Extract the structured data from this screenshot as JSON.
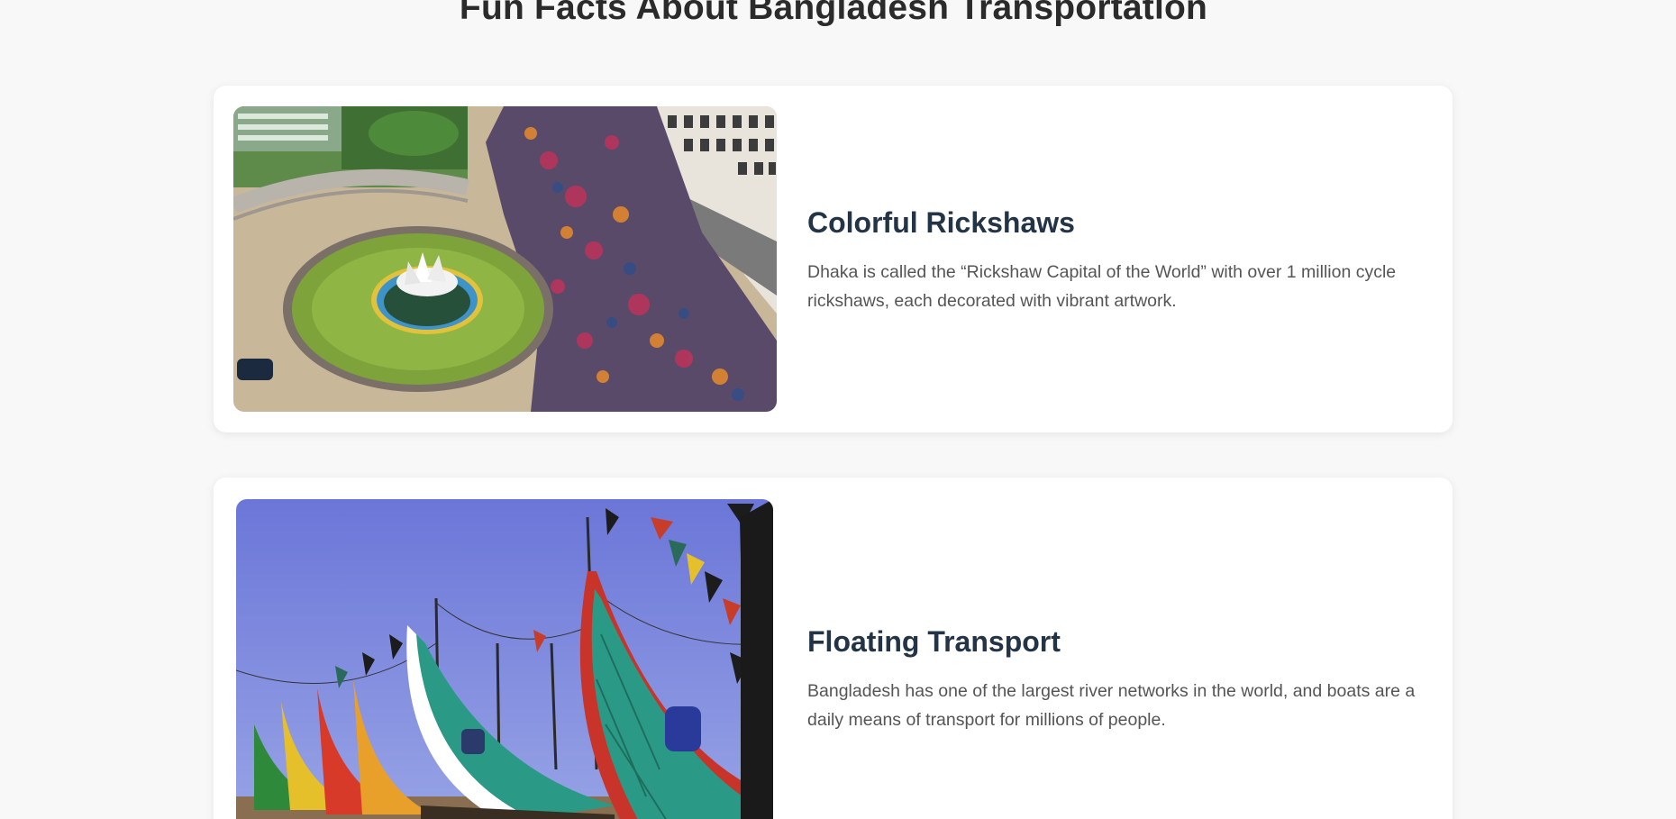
{
  "page": {
    "title": "Fun Facts About Bangladesh Transportation"
  },
  "facts": [
    {
      "heading": "Colorful Rickshaws",
      "description": "Dhaka is called the “Rickshaw Capital of the World” with over 1 million cycle rickshaws, each decorated with vibrant artwork.",
      "image_icon": "rickshaw-photo"
    },
    {
      "heading": "Floating Transport",
      "description": "Bangladesh has one of the largest river networks in the world, and boats are a daily means of transport for millions of people.",
      "image_icon": "boats-photo"
    }
  ],
  "colors": {
    "background": "#f8f8f8",
    "card": "#ffffff",
    "heading": "#243447",
    "body_text": "#555555",
    "title": "#2b2b2b"
  }
}
